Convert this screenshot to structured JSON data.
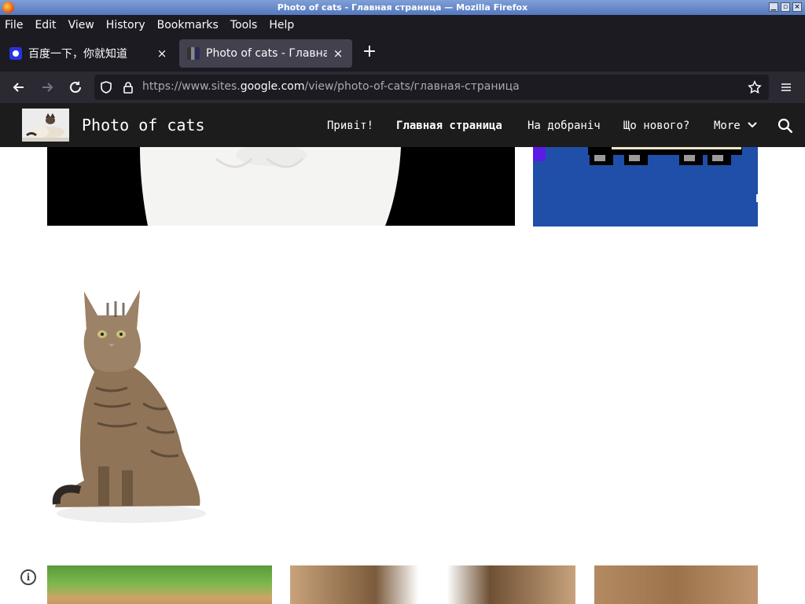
{
  "window": {
    "title": "Photo of cats - Главная страница — Mozilla Firefox"
  },
  "menu": [
    "File",
    "Edit",
    "View",
    "History",
    "Bookmarks",
    "Tools",
    "Help"
  ],
  "tabs": [
    {
      "label": "百度一下，你就知道",
      "close": "×"
    },
    {
      "label": "Photo of cats - Главная страница",
      "close": "×"
    }
  ],
  "new_tab": "+",
  "nav": {
    "url_scheme_host_prefix": "https://www.sites.",
    "url_domain": "google.com",
    "url_path": "/view/photo-of-cats/главная-страница"
  },
  "site": {
    "title": "Photo of cats",
    "nav_items": [
      "Привіт!",
      "Главная страница",
      "На добраніч",
      "Що нового?",
      "More"
    ],
    "active_nav": "Главная страница"
  },
  "colors": {
    "browser_chrome": "#1c1b22",
    "site_header": "#1c1c1c",
    "pixel_art_blue": "#1f4fa8"
  },
  "icons": [
    "back-arrow-icon",
    "forward-arrow-icon",
    "reload-icon",
    "shield-icon",
    "lock-icon",
    "star-icon",
    "hamburger-menu-icon",
    "search-icon",
    "chevron-down-icon",
    "info-icon"
  ]
}
